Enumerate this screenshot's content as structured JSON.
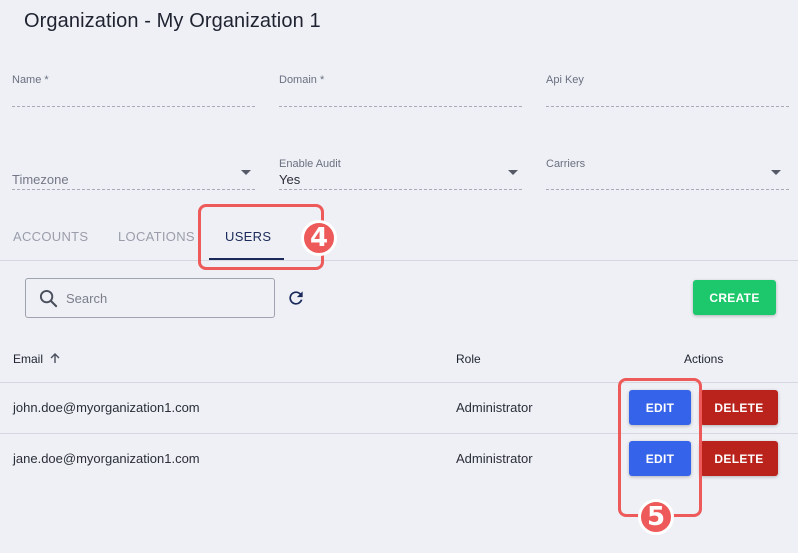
{
  "page": {
    "title": "Organization - My Organization 1"
  },
  "form": {
    "name": {
      "label": "Name *",
      "value": ""
    },
    "domain": {
      "label": "Domain *",
      "value": ""
    },
    "api_key": {
      "label": "Api Key",
      "value": ""
    },
    "timezone": {
      "placeholder": "Timezone"
    },
    "enable_audit": {
      "label": "Enable Audit",
      "value": "Yes"
    },
    "carriers": {
      "label": "Carriers",
      "value": ""
    }
  },
  "tabs": [
    {
      "label": "ACCOUNTS",
      "active": false
    },
    {
      "label": "LOCATIONS",
      "active": false
    },
    {
      "label": "USERS",
      "active": true
    }
  ],
  "toolbar": {
    "search_placeholder": "Search",
    "create_label": "CREATE"
  },
  "table": {
    "headers": {
      "email": "Email",
      "role": "Role",
      "actions": "Actions"
    },
    "sort": {
      "column": "Email",
      "direction": "ascending"
    },
    "rows": [
      {
        "email": "john.doe@myorganization1.com",
        "role": "Administrator",
        "edit_label": "EDIT",
        "delete_label": "DELETE"
      },
      {
        "email": "jane.doe@myorganization1.com",
        "role": "Administrator",
        "edit_label": "EDIT",
        "delete_label": "DELETE"
      }
    ]
  },
  "annotations": [
    {
      "number": "4",
      "target": "USERS tab"
    },
    {
      "number": "5",
      "target": "EDIT buttons"
    }
  ],
  "colors": {
    "background": "#eef0f5",
    "active_tab": "#1b2a5a",
    "create": "#1cc86b",
    "edit": "#3563e9",
    "delete": "#b9231c",
    "annotation": "#ee5a5a"
  }
}
